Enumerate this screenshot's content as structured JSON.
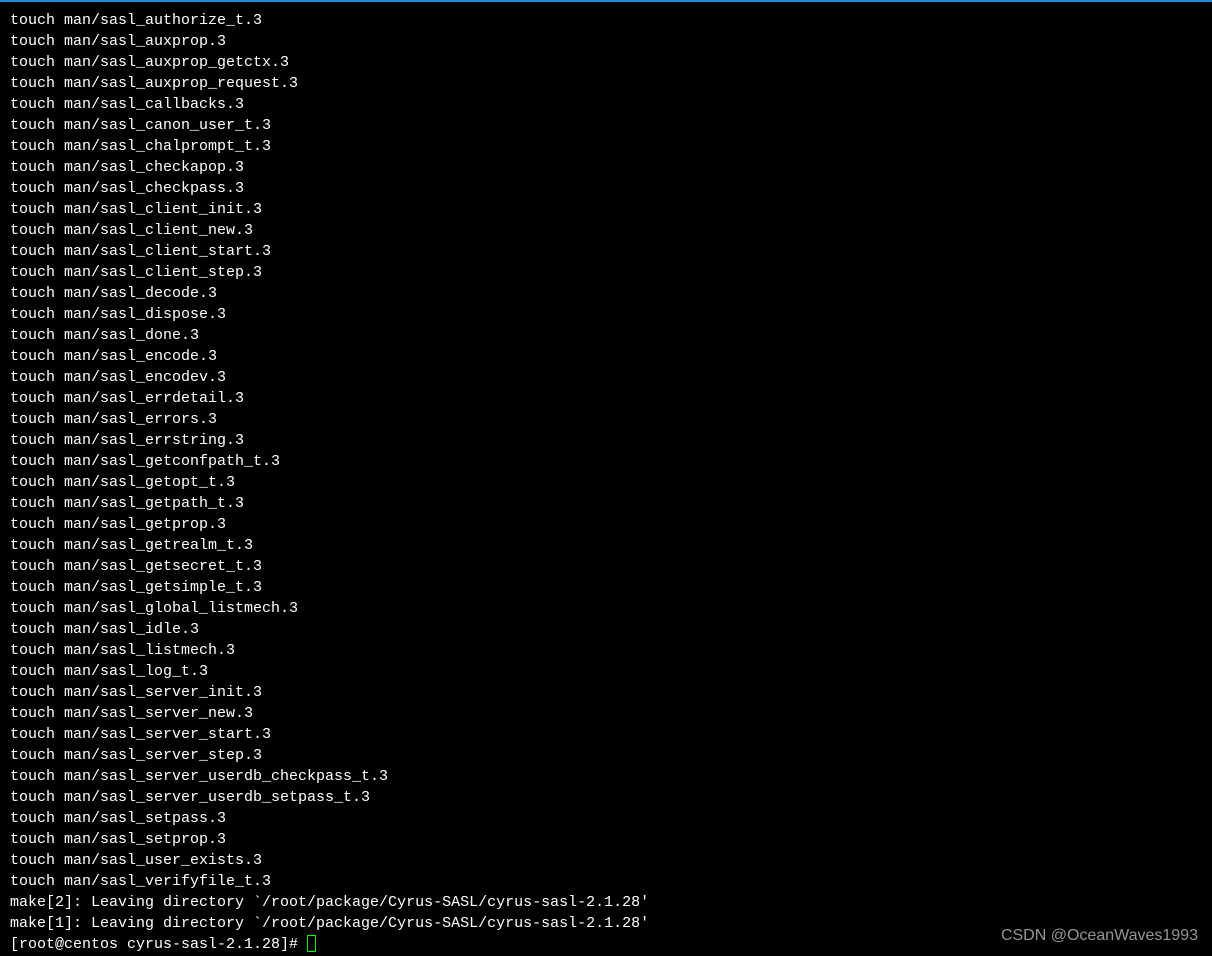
{
  "terminal": {
    "lines": [
      "touch man/sasl_authorize_t.3",
      "touch man/sasl_auxprop.3",
      "touch man/sasl_auxprop_getctx.3",
      "touch man/sasl_auxprop_request.3",
      "touch man/sasl_callbacks.3",
      "touch man/sasl_canon_user_t.3",
      "touch man/sasl_chalprompt_t.3",
      "touch man/sasl_checkapop.3",
      "touch man/sasl_checkpass.3",
      "touch man/sasl_client_init.3",
      "touch man/sasl_client_new.3",
      "touch man/sasl_client_start.3",
      "touch man/sasl_client_step.3",
      "touch man/sasl_decode.3",
      "touch man/sasl_dispose.3",
      "touch man/sasl_done.3",
      "touch man/sasl_encode.3",
      "touch man/sasl_encodev.3",
      "touch man/sasl_errdetail.3",
      "touch man/sasl_errors.3",
      "touch man/sasl_errstring.3",
      "touch man/sasl_getconfpath_t.3",
      "touch man/sasl_getopt_t.3",
      "touch man/sasl_getpath_t.3",
      "touch man/sasl_getprop.3",
      "touch man/sasl_getrealm_t.3",
      "touch man/sasl_getsecret_t.3",
      "touch man/sasl_getsimple_t.3",
      "touch man/sasl_global_listmech.3",
      "touch man/sasl_idle.3",
      "touch man/sasl_listmech.3",
      "touch man/sasl_log_t.3",
      "touch man/sasl_server_init.3",
      "touch man/sasl_server_new.3",
      "touch man/sasl_server_start.3",
      "touch man/sasl_server_step.3",
      "touch man/sasl_server_userdb_checkpass_t.3",
      "touch man/sasl_server_userdb_setpass_t.3",
      "touch man/sasl_setpass.3",
      "touch man/sasl_setprop.3",
      "touch man/sasl_user_exists.3",
      "touch man/sasl_verifyfile_t.3",
      "make[2]: Leaving directory `/root/package/Cyrus-SASL/cyrus-sasl-2.1.28'",
      "make[1]: Leaving directory `/root/package/Cyrus-SASL/cyrus-sasl-2.1.28'"
    ],
    "prompt": "[root@centos cyrus-sasl-2.1.28]# "
  },
  "watermark": "CSDN @OceanWaves1993"
}
